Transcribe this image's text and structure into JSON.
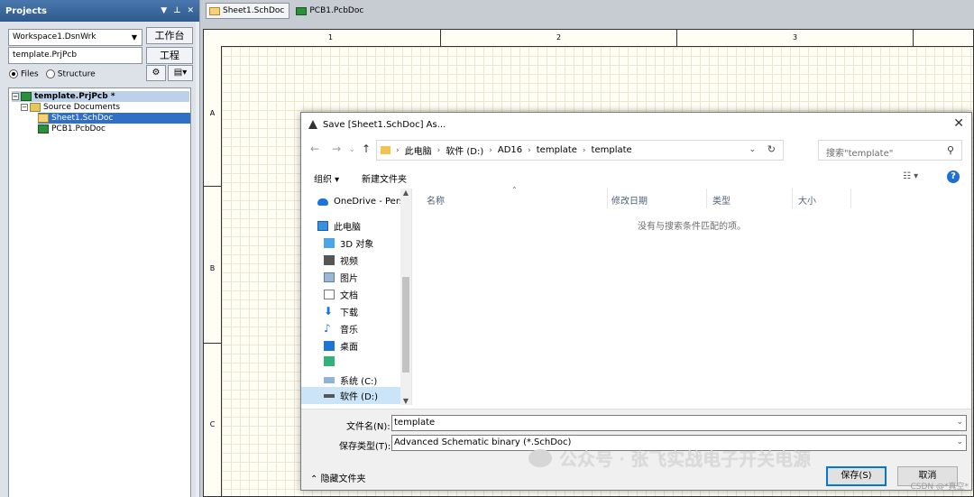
{
  "projects_panel": {
    "title": "Projects",
    "workspace": "Workspace1.DsnWrk",
    "workspace_button": "工作台",
    "project": "template.PrjPcb",
    "project_button": "工程",
    "view_files": "Files",
    "view_structure": "Structure",
    "tree": {
      "project": "template.PrjPcb *",
      "folder": "Source Documents",
      "sheet": "Sheet1.SchDoc",
      "pcb": "PCB1.PcbDoc"
    }
  },
  "tabs": [
    "Sheet1.SchDoc",
    "PCB1.PcbDoc"
  ],
  "sheet": {
    "columns": [
      "1",
      "2",
      "3"
    ],
    "rows": [
      "A",
      "B",
      "C"
    ]
  },
  "dialog": {
    "title": "Save [Sheet1.SchDoc] As...",
    "path": [
      "此电脑",
      "软件 (D:)",
      "AD16",
      "template",
      "template"
    ],
    "search_placeholder": "搜索\"template\"",
    "organize": "组织 ▾",
    "new_folder": "新建文件夹",
    "nav_items": [
      "OneDrive - Pers",
      "此电脑",
      "3D 对象",
      "视频",
      "图片",
      "文档",
      "下载",
      "音乐",
      "桌面",
      "",
      "系统 (C:)",
      "软件 (D:)"
    ],
    "columns": [
      "名称",
      "修改日期",
      "类型",
      "大小"
    ],
    "empty_message": "没有与搜索条件匹配的项。",
    "filename_label": "文件名(N):",
    "filename_value": "template",
    "filetype_label": "保存类型(T):",
    "filetype_value": "Advanced Schematic binary (*.SchDoc)",
    "hide_folders": "隐藏文件夹",
    "save_button": "保存(S)",
    "cancel_button": "取消"
  },
  "watermark": {
    "text": "公众号 · 张飞实战电子开关电源",
    "csdn": "CSDN @*真空*"
  },
  "colors": {
    "panel_header": "#2e5a8e",
    "selection": "#2f6fc7",
    "help_icon": "#1f6fd1",
    "sheet_bg": "#fffef4"
  }
}
